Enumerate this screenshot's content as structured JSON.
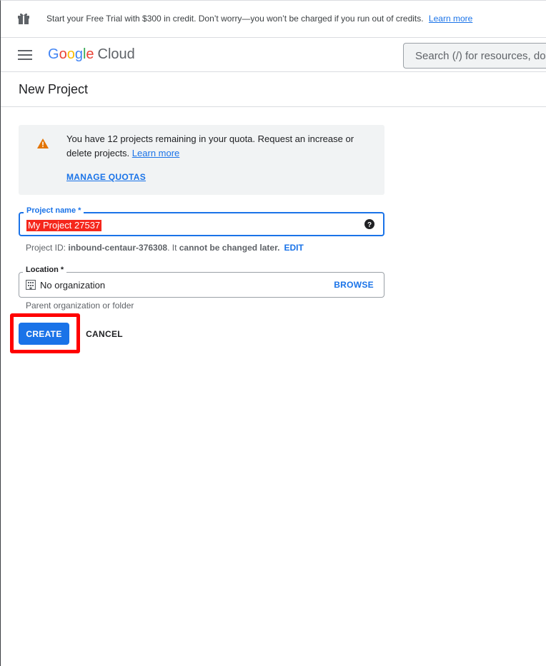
{
  "banner": {
    "icon": "gift-icon",
    "text": "Start your Free Trial with $300 in credit. Don’t worry—you won’t be charged if you run out of credits.",
    "link": "Learn more"
  },
  "header": {
    "menu_icon": "hamburger-menu-icon",
    "logo": {
      "g1": "G",
      "g2": "o",
      "g3": "o",
      "g4": "g",
      "g5": "l",
      "g6": "e",
      "product": "Cloud"
    },
    "search_placeholder": "Search (/) for resources, do"
  },
  "page": {
    "title": "New Project"
  },
  "notice": {
    "icon": "warning-icon",
    "message": "You have 12 projects remaining in your quota. Request an increase or delete projects.",
    "link": "Learn more",
    "action": "MANAGE QUOTAS"
  },
  "project_name": {
    "label": "Project name *",
    "value": "My Project 27537",
    "help_icon": "help-icon",
    "id_prefix": "Project ID: ",
    "id_value": "inbound-centaur-376308",
    "id_middle": ". It ",
    "id_bold": "cannot be changed later.",
    "edit": "EDIT"
  },
  "location": {
    "label": "Location *",
    "icon": "building-icon",
    "value": "No organization",
    "browse": "BROWSE",
    "helper": "Parent organization or folder"
  },
  "actions": {
    "create": "CREATE",
    "cancel": "CANCEL"
  },
  "colors": {
    "accent": "#1a73e8",
    "warning": "#e37400",
    "highlight": "#ff0000",
    "redaction": "#f5271c"
  }
}
